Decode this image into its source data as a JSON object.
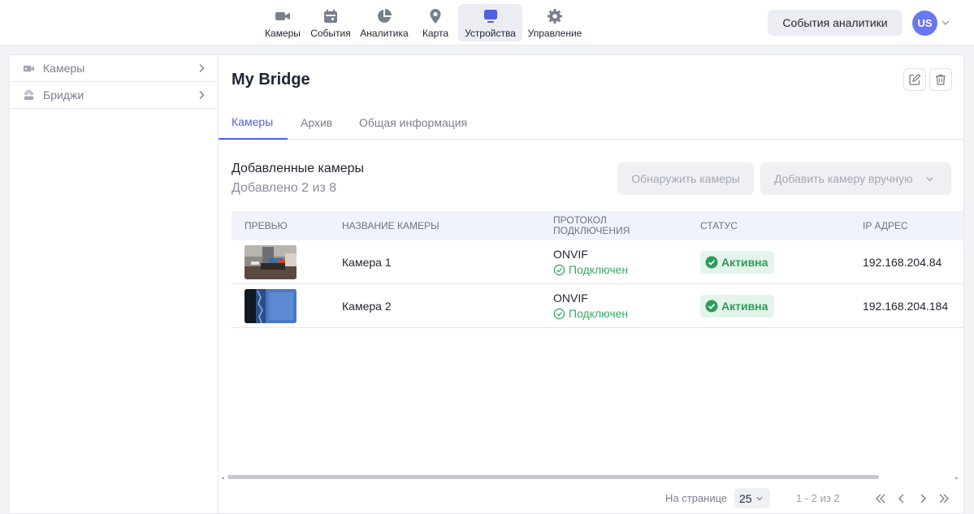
{
  "nav": {
    "items": [
      {
        "label": "Камеры",
        "icon": "camera-icon"
      },
      {
        "label": "События",
        "icon": "calendar-icon"
      },
      {
        "label": "Аналитика",
        "icon": "pie-chart-icon"
      },
      {
        "label": "Карта",
        "icon": "map-pin-icon"
      },
      {
        "label": "Устройства",
        "icon": "monitor-icon",
        "active": true
      },
      {
        "label": "Управление",
        "icon": "gear-icon"
      }
    ]
  },
  "header": {
    "analytics_button": "События аналитики",
    "avatar_initials": "US"
  },
  "sidebar": {
    "items": [
      {
        "label": "Камеры",
        "icon": "camera-icon"
      },
      {
        "label": "Бриджи",
        "icon": "bridge-icon"
      }
    ]
  },
  "main": {
    "title": "My Bridge",
    "tabs": [
      {
        "label": "Камеры",
        "active": true
      },
      {
        "label": "Архив"
      },
      {
        "label": "Общая информация"
      }
    ],
    "section_title": "Добавленные камеры",
    "section_subtitle": "Добавлено 2 из 8",
    "discover_button": "Обнаружить камеры",
    "add_manual_button": "Добавить камеру вручную",
    "table": {
      "headers": [
        "ПРЕВЬЮ",
        "НАЗВАНИЕ КАМЕРЫ",
        "ПРОТОКОЛ ПОДКЛЮЧЕНИЯ",
        "СТАТУС",
        "IP АДРЕС"
      ],
      "rows": [
        {
          "name": "Камера 1",
          "protocol": "ONVIF",
          "connection": "Подключен",
          "status": "Активна",
          "ip": "192.168.204.84"
        },
        {
          "name": "Камера 2",
          "protocol": "ONVIF",
          "connection": "Подключен",
          "status": "Активна",
          "ip": "192.168.204.184"
        }
      ]
    },
    "pagination": {
      "per_page_label": "На странице",
      "per_page_value": "25",
      "range": "1 - 2 из 2"
    }
  },
  "colors": {
    "accent": "#4f5fe3",
    "success": "#2f9a5c",
    "avatar": "#6a77f2"
  }
}
